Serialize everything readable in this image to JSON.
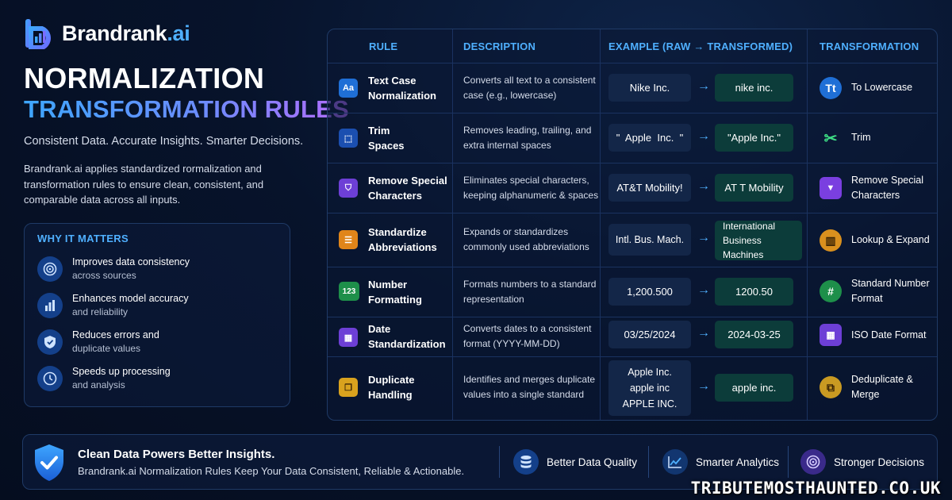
{
  "brand": {
    "name_main": "Brandrank",
    "name_suffix": ".ai"
  },
  "hero": {
    "title_line1": "NORMALIZATION",
    "title_line2": "TRANSFORMATION RULES",
    "tagline": "Consistent Data. Accurate Insights. Smarter Decisions.",
    "intro": "Brandrank.ai applies standardized rormalization and transformation rules to ensure clean, consistent, and comparable data across all inputs."
  },
  "why": {
    "title": "WHY IT MATTERS",
    "items": [
      {
        "icon": "target-icon",
        "main": "Improves data consistency",
        "sub": "across sources"
      },
      {
        "icon": "bar-chart-icon",
        "main": "Enhances model accuracy",
        "sub": "and reliability"
      },
      {
        "icon": "shield-check-icon",
        "main": "Reduces errors and",
        "sub": "duplicate values"
      },
      {
        "icon": "clock-icon",
        "main": "Speeds up processing",
        "sub": "and analysis"
      }
    ]
  },
  "table": {
    "headers": {
      "rule": "RULE",
      "description": "DESCRIPTION",
      "example": "EXAMPLE (RAW → TRANSFORMED)",
      "transformation": "TRANSFORMATION"
    },
    "arrow": "→",
    "rows": [
      {
        "rule_icon_text": "Aa",
        "rule": "Text Case Normalization",
        "description": "Converts all text to a consistent case (e.g., lowercase)",
        "raw": "Nike Inc.",
        "transformed": "nike inc.",
        "tr_icon_text": "Tt",
        "transformation": "To Lowercase"
      },
      {
        "rule_icon_text": "⬚",
        "rule": "Trim Spaces",
        "description": "Removes leading, trailing, and extra internal spaces",
        "raw": "\"  Apple  Inc.  \"",
        "transformed": "\"Apple Inc.\"",
        "tr_icon_text": "✂",
        "transformation": "Trim"
      },
      {
        "rule_icon_text": "⛉",
        "rule": "Remove Special Characters",
        "description": "Eliminates special characters, keeping alphanumeric & spaces",
        "raw": "AT&T Mobility!",
        "transformed": "AT T Mobility",
        "tr_icon_text": "▼",
        "transformation": "Remove Special Characters"
      },
      {
        "rule_icon_text": "☰",
        "rule": "Standardize Abbreviations",
        "description": "Expands or standardizes commonly used abbreviations",
        "raw": "Intl. Bus. Mach.",
        "transformed": "International Business Machines",
        "tr_icon_text": "▥",
        "transformation": "Lookup & Expand"
      },
      {
        "rule_icon_text": "123",
        "rule": "Number Formatting",
        "description": "Formats numbers to a standard representation",
        "raw": "1,200.500",
        "transformed": "1200.50",
        "tr_icon_text": "#",
        "transformation": "Standard Number Format"
      },
      {
        "rule_icon_text": "▦",
        "rule": "Date Standardization",
        "description": "Converts dates to a consistent format (YYYY-MM-DD)",
        "raw": "03/25/2024",
        "transformed": "2024-03-25",
        "tr_icon_text": "▦",
        "transformation": "ISO Date Format"
      },
      {
        "rule_icon_text": "❐",
        "rule": "Duplicate Handling",
        "description": "Identifies and merges duplicate values into a single standard",
        "raw_lines": [
          "Apple Inc.",
          "apple inc",
          "APPLE INC."
        ],
        "transformed": "apple inc.",
        "tr_icon_text": "⧉",
        "transformation": "Deduplicate & Merge"
      }
    ]
  },
  "footer": {
    "title": "Clean Data Powers Better Insights.",
    "subtitle": "Brandrank.ai Normalization Rules Keep Your Data Consistent, Reliable & Actionable.",
    "features": [
      {
        "icon": "database-icon",
        "label": "Better Data Quality"
      },
      {
        "icon": "line-chart-icon",
        "label": "Smarter Analytics"
      },
      {
        "icon": "target-icon",
        "label": "Stronger Decisions"
      }
    ]
  },
  "watermark": "TRIBUTEMOSTHAUNTED.CO.UK",
  "colors": {
    "accent": "#4fb0ff",
    "background": "#07132b",
    "panel_border": "#1f3a66",
    "output_box": "#0c3c3a",
    "input_box": "#132648"
  }
}
